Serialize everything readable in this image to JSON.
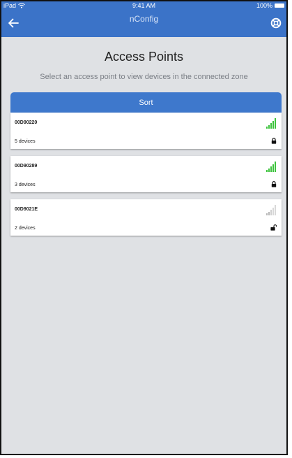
{
  "status_bar": {
    "device": "iPad",
    "time": "9:41 AM",
    "battery": "100%"
  },
  "nav": {
    "title": "nConfig",
    "back_icon": "arrow-left-icon",
    "help_icon": "lifebuoy-icon"
  },
  "page": {
    "title": "Access Points",
    "subtitle": "Select an access point to view devices in the connected zone"
  },
  "sort_button": {
    "label": "Sort"
  },
  "colors": {
    "app_bar": "#3b73c8",
    "background": "#dfe1e4",
    "signal_strong": "#3cc33c",
    "signal_weak": "#b8b8b8"
  },
  "access_points": [
    {
      "name": "00D90220",
      "devices": "5 devices",
      "signal_bars": 5,
      "locked": true
    },
    {
      "name": "00D90289",
      "devices": "3 devices",
      "signal_bars": 5,
      "locked": true
    },
    {
      "name": "00D9021E",
      "devices": "2 devices",
      "signal_bars": 2,
      "locked": false
    }
  ]
}
